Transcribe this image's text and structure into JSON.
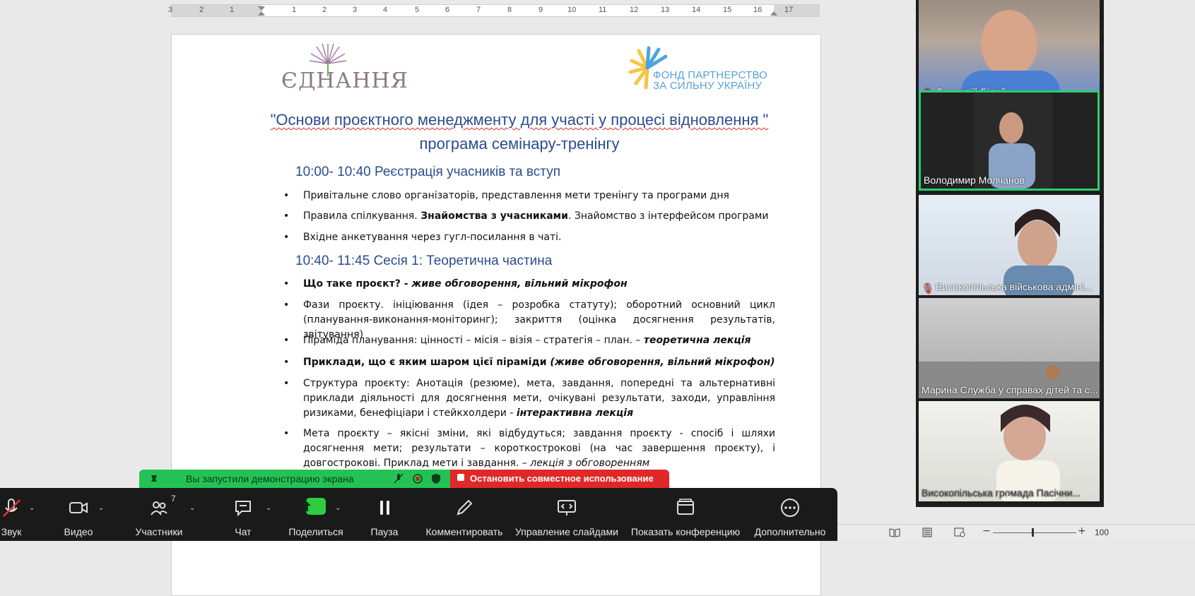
{
  "ruler": {
    "left_numbers": [
      "3",
      "2",
      "1"
    ],
    "right_numbers": [
      "1",
      "2",
      "3",
      "4",
      "5",
      "6",
      "7",
      "8",
      "9",
      "10",
      "11",
      "12",
      "13",
      "14",
      "15",
      "16",
      "17"
    ]
  },
  "logos": {
    "left": "ЄДНАННЯ",
    "right_line1": "ФОНД ПАРТНЕРСТВО",
    "right_line2": "ЗА СИЛЬНУ УКРАЇНУ"
  },
  "document": {
    "title_line1": "\"Основи проєктного менеджменту для участі у процесі відновлення \"",
    "title_line2": "програма семінару-тренінгу",
    "section1_heading": "10:00- 10:40 Реєстрація учасників та вступ",
    "section1_items": [
      "Привітальне слово організаторів, представлення мети тренінгу та програми дня",
      "Правила спілкування. ",
      "Знайомства з учасниками",
      ". Знайомство з інтерфейсом програми",
      "Вхідне анкетування через гугл-посилання в чаті."
    ],
    "section2_heading": "10:40- 11:45 Сесія 1: Теоретична частина",
    "s2_b1_bold": "Що таке проєкт? - ",
    "s2_b1_bi": " живе обговорення, вільний мікрофон",
    "s2_b2": "Фази проєкту. ініціювання (ідея – розробка статуту); оборотний основний цикл (планування-виконання-моніторинг); закриття (оцінка досягнення результатів, звітування)",
    "s2_b3": "Піраміда планування: цінності – місія – візія – стратегія – план.  – ",
    "s2_b3_bi": "теоретична лекція",
    "s2_b4_b": "Приклади, що є яким шаром цієї піраміди ",
    "s2_b4_bi": "(живе обговорення, вільний мікрофон)",
    "s2_b5": "Структура проєкту: Анотація (резюме), мета, завдання, попередні та альтернативні приклади діяльності для досягнення мети, очікувані результати, заходи, управління ризиками, бенефіціари і стейкхолдери - ",
    "s2_b5_bi": "інтерактивна лекція",
    "s2_b6": "Мета проєкту – якісні зміни, які відбудуться; завдання проєкту -  спосіб і шляхи досягнення мети; результати – короткострокові (на час завершення проєкту), і довгострокові. Приклад мети і завдання. – ",
    "s2_b6_i": "лекція з обговоренням"
  },
  "participants": [
    {
      "name": "Дементій Білий",
      "muted": true
    },
    {
      "name": "Володимир Молчанов",
      "muted": false,
      "active": true
    },
    {
      "name": "Високопільська військова адміні...",
      "muted": true
    },
    {
      "name": "Марина Служба у справах дітей та с...",
      "muted": false
    },
    {
      "name": "Високопільська громада Пасічни...",
      "muted": false
    }
  ],
  "share_banner": {
    "status": "Вы запустили демонстрацию экрана",
    "stop": "Остановить совместное использование"
  },
  "toolbar": {
    "audio": "Звук",
    "video": "Видео",
    "participants": "Участники",
    "participants_count": "7",
    "chat": "Чат",
    "share": "Поделиться",
    "pause": "Пауза",
    "annotate": "Комментировать",
    "slides": "Управление слайдами",
    "show_meeting": "Показать конференцию",
    "more": "Дополнительно"
  },
  "statusbar": {
    "zoom": "100"
  },
  "colors": {
    "heading": "#2a4d8f",
    "share_green": "#24c254",
    "stop_red": "#e02828",
    "active_tile": "#2ecc71"
  }
}
